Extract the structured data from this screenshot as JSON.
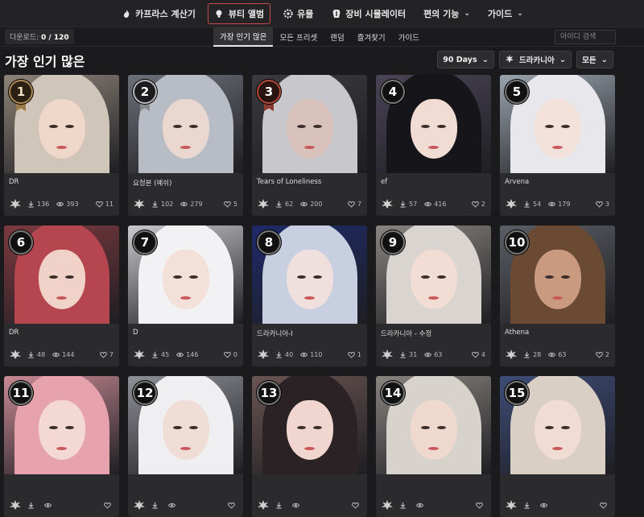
{
  "nav": [
    {
      "id": "calc",
      "label": "카프라스 계산기",
      "icon": "flame-icon",
      "chevron": false,
      "active": false
    },
    {
      "id": "beauty",
      "label": "뷰티 앨범",
      "icon": "bulb-icon",
      "chevron": false,
      "active": true
    },
    {
      "id": "relic",
      "label": "유물",
      "icon": "gear-icon",
      "chevron": false,
      "active": false
    },
    {
      "id": "gear",
      "label": "장비 시뮬레이터",
      "icon": "armor-icon",
      "chevron": false,
      "active": false
    },
    {
      "id": "util",
      "label": "편의 기능",
      "icon": "",
      "chevron": true,
      "active": false
    },
    {
      "id": "guide",
      "label": "가이드",
      "icon": "",
      "chevron": true,
      "active": false
    }
  ],
  "download_counter": {
    "label": "다운로드: ",
    "value": "0 / 120"
  },
  "subtabs": [
    "가장 인기 많은",
    "모든 프리셋",
    "랜덤",
    "즐겨찾기",
    "가이드"
  ],
  "subtab_active": 0,
  "search": {
    "placeholder": "아이디 검색",
    "value": ""
  },
  "page_title": "가장 인기 많은",
  "filters": {
    "period": "90 Days",
    "class": "드라카니아",
    "scope": "모든"
  },
  "colors": {
    "accent": "#c94a4a",
    "background": "#1b1b1d",
    "card": "#2b2b2e"
  },
  "cards": [
    {
      "rank": "1",
      "title": "DR",
      "downloads": "136",
      "views": "393",
      "likes": "11",
      "hair": "#cfc5b8",
      "skin": "#efd7c9",
      "bg": "#8e8479"
    },
    {
      "rank": "2",
      "title": "요청본 (예쉬)",
      "downloads": "102",
      "views": "279",
      "likes": "5",
      "hair": "#b8bcc4",
      "skin": "#e9d7d0",
      "bg": "#6c7079"
    },
    {
      "rank": "3",
      "title": "Tears of Loneliness",
      "downloads": "62",
      "views": "200",
      "likes": "7",
      "hair": "#c8c8cc",
      "skin": "#d9c2bb",
      "bg": "#3a3a3f"
    },
    {
      "rank": "4",
      "title": "ef",
      "downloads": "57",
      "views": "416",
      "likes": "2",
      "hair": "#15151a",
      "skin": "#f1dcd4",
      "bg": "#4a4456"
    },
    {
      "rank": "5",
      "title": "Arvena",
      "downloads": "54",
      "views": "179",
      "likes": "3",
      "hair": "#e8e8ec",
      "skin": "#f3e2db",
      "bg": "#9aa3ad"
    },
    {
      "rank": "6",
      "title": "DR",
      "downloads": "48",
      "views": "144",
      "likes": "7",
      "hair": "#b5454f",
      "skin": "#f0d2c8",
      "bg": "#7d3a40"
    },
    {
      "rank": "7",
      "title": "D",
      "downloads": "45",
      "views": "146",
      "likes": "0",
      "hair": "#f2f2f4",
      "skin": "#f3e1d9",
      "bg": "#c9c9cd"
    },
    {
      "rank": "8",
      "title": "드라카니아-I",
      "downloads": "40",
      "views": "110",
      "likes": "1",
      "hair": "#c8cfe0",
      "skin": "#efe0de",
      "bg": "#1e2a6a"
    },
    {
      "rank": "9",
      "title": "드라카니아 - 수정",
      "downloads": "31",
      "views": "63",
      "likes": "4",
      "hair": "#d9d4cf",
      "skin": "#f1ddd3",
      "bg": "#8a8580"
    },
    {
      "rank": "10",
      "title": "Athena",
      "downloads": "28",
      "views": "63",
      "likes": "2",
      "hair": "#6b4a34",
      "skin": "#c99a80",
      "bg": "#5b5e66"
    },
    {
      "rank": "11",
      "title": "",
      "downloads": "",
      "views": "",
      "likes": "",
      "hair": "#e6a2ad",
      "skin": "#f3d8d3",
      "bg": "#c98a95"
    },
    {
      "rank": "12",
      "title": "",
      "downloads": "",
      "views": "",
      "likes": "",
      "hair": "#efeff1",
      "skin": "#f0ddd5",
      "bg": "#8e9098"
    },
    {
      "rank": "13",
      "title": "",
      "downloads": "",
      "views": "",
      "likes": "",
      "hair": "#2a2224",
      "skin": "#f0d6ce",
      "bg": "#6a5552"
    },
    {
      "rank": "14",
      "title": "",
      "downloads": "",
      "views": "",
      "likes": "",
      "hair": "#d8d2cc",
      "skin": "#efd9cf",
      "bg": "#8a8480"
    },
    {
      "rank": "15",
      "title": "",
      "downloads": "",
      "views": "",
      "likes": "",
      "hair": "#d9cfc4",
      "skin": "#f0dcd2",
      "bg": "#3e4d78"
    }
  ]
}
